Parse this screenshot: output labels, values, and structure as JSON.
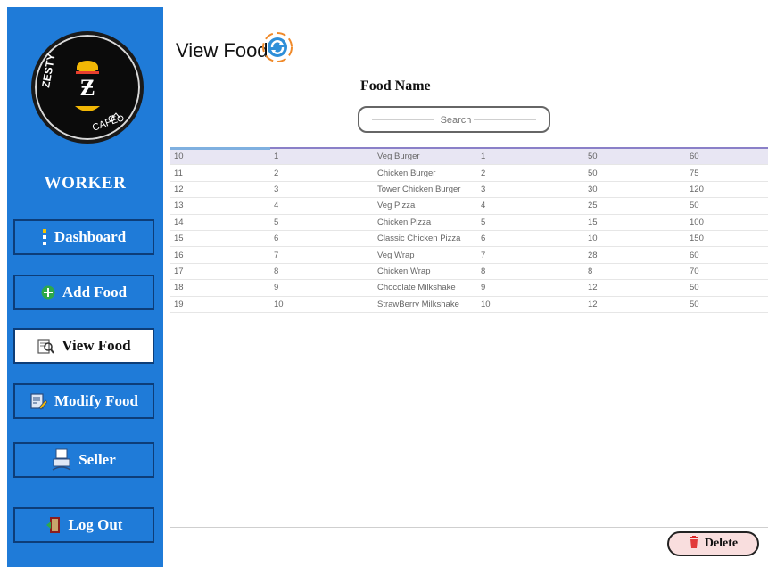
{
  "header": {
    "title": "View Food",
    "refresh_icon": "refresh-icon"
  },
  "logo": {
    "brand": "ZESTY CAFÉ"
  },
  "sidebar": {
    "role": "WORKER",
    "items": [
      {
        "label": "Dashboard",
        "icon": "menu-dots-icon"
      },
      {
        "label": "Add Food",
        "icon": "plus-circle-icon"
      },
      {
        "label": "View Food",
        "icon": "magnifier-list-icon",
        "active": true
      },
      {
        "label": "Modify Food",
        "icon": "edit-form-icon"
      },
      {
        "label": "Seller",
        "icon": "cashier-icon"
      },
      {
        "label": "Log Out",
        "icon": "exit-door-icon"
      }
    ]
  },
  "search": {
    "label": "Food Name",
    "placeholder": "Search"
  },
  "table": {
    "selected_row": 0,
    "rows": [
      [
        "10",
        "1",
        "Veg Burger",
        "1",
        "50",
        "60"
      ],
      [
        "11",
        "2",
        "Chicken Burger",
        "2",
        "50",
        "75"
      ],
      [
        "12",
        "3",
        "Tower Chicken Burger",
        "3",
        "30",
        "120"
      ],
      [
        "13",
        "4",
        "Veg Pizza",
        "4",
        "25",
        "50"
      ],
      [
        "14",
        "5",
        "Chicken Pizza",
        "5",
        "15",
        "100"
      ],
      [
        "15",
        "6",
        "Classic Chicken Pizza",
        "6",
        "10",
        "150"
      ],
      [
        "16",
        "7",
        "Veg Wrap",
        "7",
        "28",
        "60"
      ],
      [
        "17",
        "8",
        "Chicken Wrap",
        "8",
        "8",
        "70"
      ],
      [
        "18",
        "9",
        "Chocolate Milkshake",
        "9",
        "12",
        "50"
      ],
      [
        "19",
        "10",
        "StrawBerry Milkshake",
        "10",
        "12",
        "50"
      ]
    ]
  },
  "actions": {
    "delete_label": "Delete",
    "delete_icon": "trash-icon"
  },
  "colors": {
    "sidebar": "#1f7bd8",
    "sidebar_border": "#0d3d78",
    "delete_bg": "#f9dede",
    "selected_row": "#e8e6f3"
  }
}
